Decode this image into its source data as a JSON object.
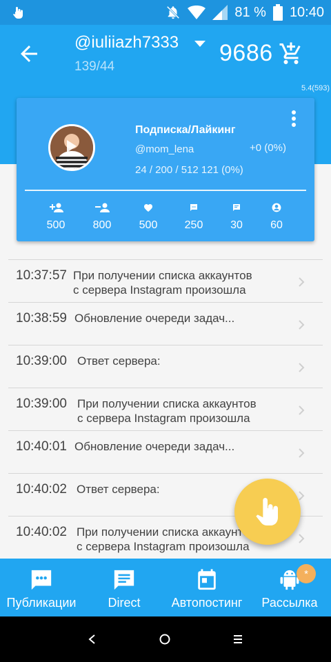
{
  "status_bar": {
    "battery": "81 %",
    "time": "10:40",
    "left_icon": "touch-icon",
    "icons": [
      "bell-off-icon",
      "wifi-icon",
      "signal-icon",
      "battery-icon"
    ]
  },
  "header": {
    "account": "@iuliiazh7333",
    "account_sub": "139/44",
    "credits": "9686",
    "version": "5.4(593)"
  },
  "card": {
    "title": "Подписка/Лайкинг",
    "handle": "@mom_lena",
    "delta": "+0 (0%)",
    "stats": "24 / 200 / 512 121 (0%)",
    "counters": [
      {
        "icon": "follow-icon",
        "value": "500"
      },
      {
        "icon": "unfollow-icon",
        "value": "800"
      },
      {
        "icon": "heart-icon",
        "value": "500"
      },
      {
        "icon": "comment-icon",
        "value": "250"
      },
      {
        "icon": "message-icon",
        "value": "30"
      },
      {
        "icon": "profile-icon",
        "value": "60"
      }
    ]
  },
  "log": [
    {
      "time": "10:37:57",
      "msg1": "При получении списка аккаунтов",
      "msg2": "с сервера Instagram произошла"
    },
    {
      "time": "10:38:59",
      "msg1": "Обновление очереди задач...",
      "msg2": ""
    },
    {
      "time": "10:39:00",
      "msg1": "Ответ сервера:",
      "msg2": ""
    },
    {
      "time": "10:39:00",
      "msg1": "При получении списка аккаунтов",
      "msg2": "с сервера Instagram произошла"
    },
    {
      "time": "10:40:01",
      "msg1": "Обновление очереди задач...",
      "msg2": ""
    },
    {
      "time": "10:40:02",
      "msg1": "Ответ сервера:",
      "msg2": ""
    },
    {
      "time": "10:40:02",
      "msg1": "При получении списка аккаунтов",
      "msg2": "с сервера Instagram произошла"
    }
  ],
  "bottom_nav": [
    {
      "label": "Публикации",
      "icon": "publications-icon"
    },
    {
      "label": "Direct",
      "icon": "direct-icon"
    },
    {
      "label": "Автопостинг",
      "icon": "calendar-icon"
    },
    {
      "label": "Рассылка",
      "icon": "android-icon"
    }
  ],
  "badge": "*",
  "colors": {
    "primary": "#21a6f1",
    "status_bar": "#1e94df",
    "card": "#39a7f4",
    "fab": "#f7cd52",
    "badge": "#f4b05c"
  }
}
